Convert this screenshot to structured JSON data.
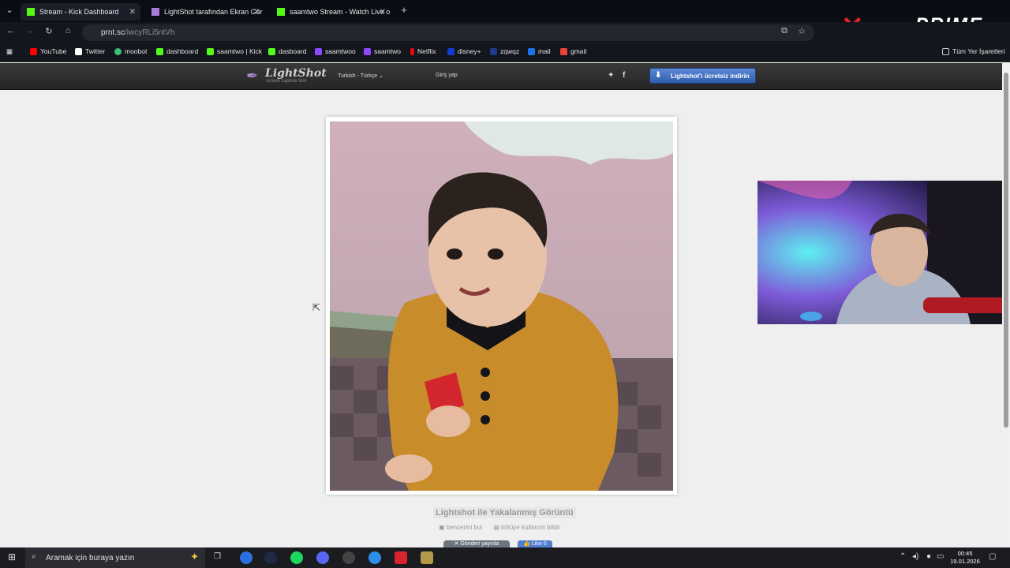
{
  "tabs": [
    {
      "title": "Stream - Kick Dashboard",
      "color": "#53fc18"
    },
    {
      "title": "LightShot tarafından Ekran Gör",
      "color": "#a57cd8"
    },
    {
      "title": "saamtwo Stream - Watch Live o",
      "color": "#53fc18"
    }
  ],
  "address": {
    "host": "prnt.sc",
    "path": "/iwcyRLi5ntVh"
  },
  "bookmarks": [
    {
      "label": "YouTube",
      "color": "#ff0000"
    },
    {
      "label": "Twitter",
      "color": "#ffffff"
    },
    {
      "label": "moobot",
      "color": "#38c172"
    },
    {
      "label": "dashboard",
      "color": "#53fc18"
    },
    {
      "label": "saamtwo | Kick",
      "color": "#53fc18"
    },
    {
      "label": "dasboard",
      "color": "#53fc18"
    },
    {
      "label": "saamtwoo",
      "color": "#9146ff"
    },
    {
      "label": "saamtwo",
      "color": "#9146ff"
    },
    {
      "label": "Netflix",
      "color": "#e50914"
    },
    {
      "label": "disney+",
      "color": "#113ccf"
    },
    {
      "label": "zqwqz",
      "color": "#1e3a8a"
    },
    {
      "label": "mail",
      "color": "#1a73e8"
    },
    {
      "label": "gmail",
      "color": "#ea4335"
    }
  ],
  "all_bookmarks": "Tüm Yer İşaretleri",
  "overlay_brand": "PRIME",
  "lightshot": {
    "logo": "LightShot",
    "tagline": "screen capture tool",
    "language": "Turkish - Türkçe",
    "login": "Giriş yap",
    "download": "Lightshot'ı ücretsiz indirin"
  },
  "page": {
    "caption": "Lightshot ile Yakalanmış Görüntü",
    "similar": "benzerini bul",
    "report": "kötüye kullanım bildir",
    "share": "Gönderi yayınla",
    "like": "Like 0"
  },
  "taskbar": {
    "search_placeholder": "Aramak için buraya yazın",
    "time": "00:45",
    "date": "19.01.2026"
  }
}
